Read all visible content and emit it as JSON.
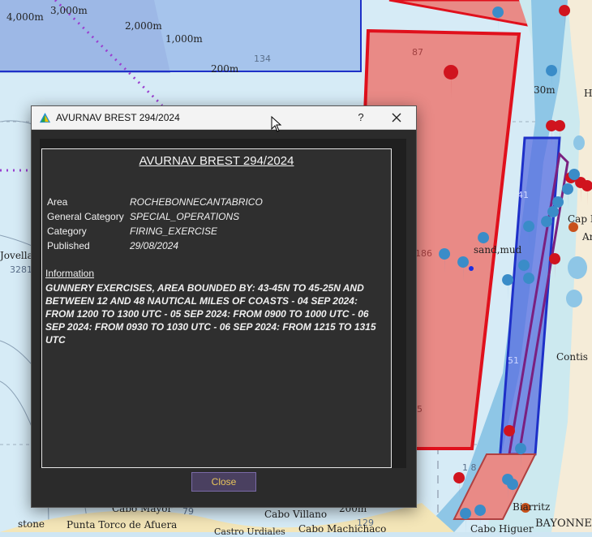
{
  "window": {
    "title": "AVURNAV BREST 294/2024",
    "help_label": "?",
    "close_button_label": "Close"
  },
  "notice": {
    "header": "AVURNAV BREST 294/2024",
    "fields": [
      {
        "key": "Area",
        "value": "ROCHEBONNECANTABRICO"
      },
      {
        "key": "General Category",
        "value": "SPECIAL_OPERATIONS"
      },
      {
        "key": "Category",
        "value": "FIRING_EXERCISE"
      },
      {
        "key": "Published",
        "value": "29/08/2024"
      }
    ],
    "info_label": "Information",
    "info_text": "GUNNERY EXERCISES, AREA BOUNDED BY: 43-45N TO 45-25N AND BETWEEN 12 AND 48 NAUTICAL MILES OF COASTS - 04 SEP 2024: FROM 1200 TO 1300 UTC - 05 SEP 2024: FROM 0900 TO 1000 UTC - 06 SEP 2024: FROM 0930 TO 1030 UTC - 06 SEP 2024: FROM 1215 TO 1315 UTC"
  },
  "map": {
    "depth_labels": [
      "4,000m",
      "3,000m",
      "2,000m",
      "1,000m",
      "200m",
      "134",
      "87",
      "30m",
      "41",
      "186",
      "51",
      "5",
      "1 8",
      "79",
      "200m",
      "129",
      "3281"
    ],
    "place_labels": [
      "Jovella",
      "sand,mud",
      "Cap B",
      "Contis",
      "Biarritz",
      "BAYONNE",
      "Cabo Higuer",
      "Cabo Mayor",
      "Cabo Villano",
      "Cabo Machichaco",
      "Punta Torco de Afuera",
      "stone",
      "Castro Urdiales",
      "An",
      "H"
    ]
  },
  "colors": {
    "accent_red": "#e0101c",
    "area_fill": "#e98a86",
    "blue_zone": "#3a58e0",
    "marker_blue": "#3a8cc8",
    "marker_red": "#d0141e",
    "button_text": "#e7c45a"
  }
}
